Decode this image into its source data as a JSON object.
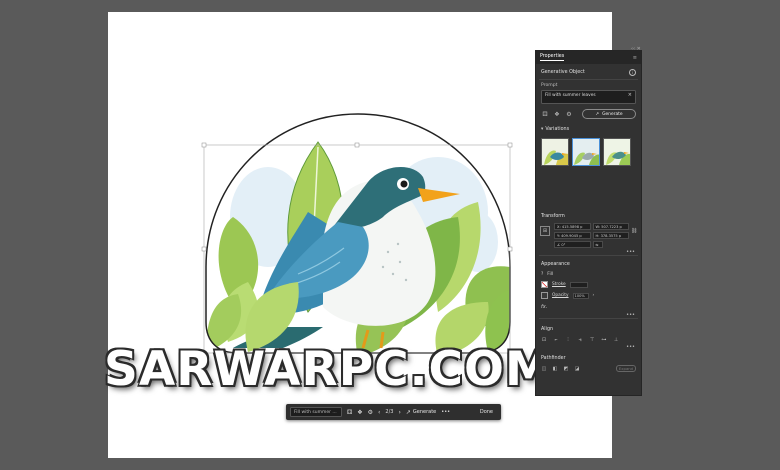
{
  "canvas": {
    "background": "#5a5a5a",
    "artboard_color": "#ffffff"
  },
  "watermark": {
    "text": "SARWARPC.COM"
  },
  "panel": {
    "tab": "Properties",
    "object_type": "Generative Object",
    "prompt_label": "Prompt",
    "prompt_value": "Fill with summer leaves",
    "generate_label": "Generate",
    "variations_label": "Variations",
    "transform": {
      "title": "Transform",
      "x": "415.5898 p",
      "w": "507.7223 p",
      "y": "409.9045 p",
      "h": "378.3575 p",
      "angle": "0°"
    },
    "appearance": {
      "title": "Appearance",
      "fill_label": "Fill",
      "stroke_label": "Stroke",
      "opacity_label": "Opacity",
      "opacity_value": "100%",
      "fx_label": "fx."
    },
    "align_title": "Align",
    "pathfinder_title": "Pathfinder",
    "expand_label": "Expand"
  },
  "taskbar": {
    "prompt": "Fill with summer ...",
    "page": "2/3",
    "generate_label": "Generate",
    "more_label": "•••",
    "done_label": "Done"
  },
  "colors": {
    "accent_selected": "#4a90d9",
    "bird_body": "#2e6f78",
    "bird_beak": "#f2a21b",
    "leaf_light": "#a9cf5b",
    "leaf_dark": "#5f9a3a"
  }
}
